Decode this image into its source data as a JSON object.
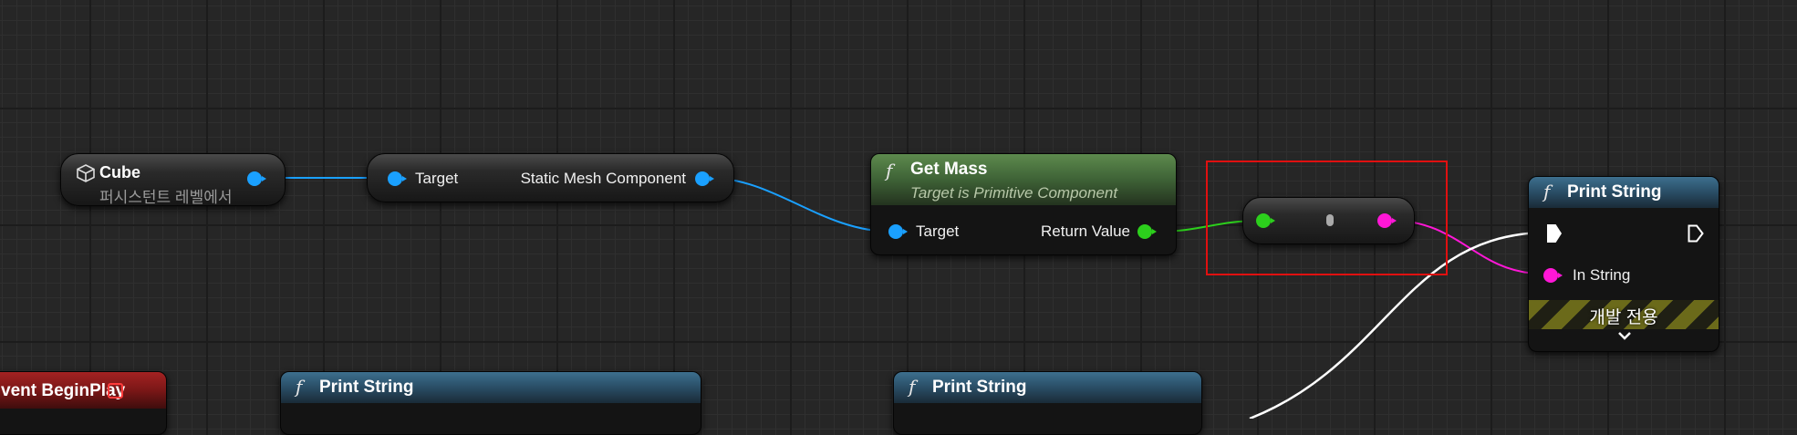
{
  "nodes": {
    "cube": {
      "title": "Cube",
      "subtitle": "퍼시스턴트 레벨에서"
    },
    "static_mesh_getter": {
      "target_label": "Target",
      "output_label": "Static Mesh Component"
    },
    "get_mass": {
      "fx": "f",
      "title": "Get Mass",
      "subtitle": "Target is Primitive Component",
      "target_label": "Target",
      "return_label": "Return Value"
    },
    "print_string_main": {
      "fx": "f",
      "title": "Print String",
      "in_string_label": "In String",
      "dev_only_label": "개발 전용"
    },
    "event_begin_play": {
      "title": "vent BeginPlay"
    },
    "print_string_2": {
      "fx": "f",
      "title": "Print String"
    },
    "print_string_3": {
      "fx": "f",
      "title": "Print String"
    }
  },
  "colors": {
    "object_pin": "#1aa0ff",
    "float_pin": "#2ccf1c",
    "string_pin": "#ff17d7",
    "exec_wire": "#ffffff",
    "highlight": "#e01010"
  }
}
